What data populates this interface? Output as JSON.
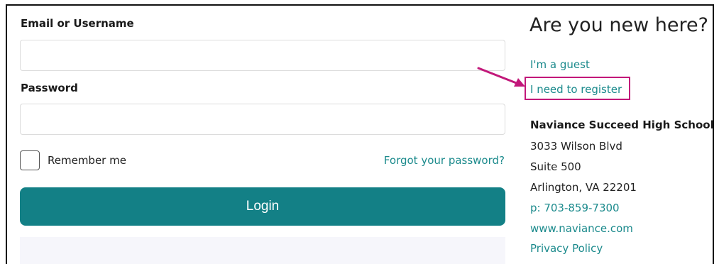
{
  "form": {
    "email_label": "Email or Username",
    "email_value": "",
    "email_placeholder": "",
    "password_label": "Password",
    "password_value": "",
    "password_placeholder": "",
    "remember_label": "Remember me",
    "remember_checked": false,
    "forgot_link": "Forgot your password?",
    "login_label": "Login"
  },
  "side": {
    "heading": "Are you new here?",
    "guest_link": "I'm a guest",
    "register_link": "I need to register",
    "school_name": "Naviance Succeed High School",
    "address_line1": "3033 Wilson Blvd",
    "address_line2": "Suite 500",
    "address_line3": "Arlington, VA 22201",
    "phone": "p: 703-859-7300",
    "website": "www.naviance.com",
    "privacy_link": "Privacy Policy"
  },
  "colors": {
    "primary_button": "#138086",
    "link": "#1b8a8c",
    "highlight": "#c2187a"
  }
}
